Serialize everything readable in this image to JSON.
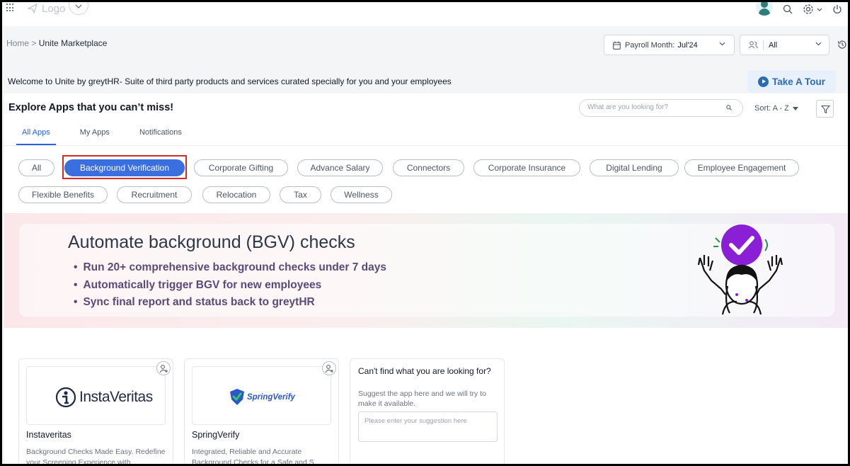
{
  "topbar": {
    "logo_text": "Logo"
  },
  "breadcrumb": {
    "home": "Home",
    "separator": ">",
    "current": "Unite Marketplace"
  },
  "payroll": {
    "label": "Payroll Month:",
    "value": "Jul'24"
  },
  "scope": {
    "value": "All"
  },
  "welcome": {
    "text": "Welcome to Unite by greytHR- Suite of third party products and services curated specially for you and your employees",
    "tour_label": "Take A Tour"
  },
  "explore": {
    "title": "Explore Apps that you can’t miss!",
    "search_placeholder": "What are you looking for?",
    "sort_label": "Sort: A - Z"
  },
  "tabs": [
    {
      "label": "All Apps",
      "active": true
    },
    {
      "label": "My Apps",
      "active": false
    },
    {
      "label": "Notifications",
      "active": false
    }
  ],
  "categories": [
    {
      "label": "All",
      "selected": false
    },
    {
      "label": "Background Verification",
      "selected": true
    },
    {
      "label": "Corporate Gifting",
      "selected": false
    },
    {
      "label": "Advance Salary",
      "selected": false
    },
    {
      "label": "Connectors",
      "selected": false
    },
    {
      "label": "Corporate Insurance",
      "selected": false
    },
    {
      "label": "Digital Lending",
      "selected": false
    },
    {
      "label": "Employee Engagement",
      "selected": false
    },
    {
      "label": "Flexible Benefits",
      "selected": false
    },
    {
      "label": "Recruitment",
      "selected": false
    },
    {
      "label": "Relocation",
      "selected": false
    },
    {
      "label": "Tax",
      "selected": false
    },
    {
      "label": "Wellness",
      "selected": false
    }
  ],
  "banner": {
    "title": "Automate background (BGV) checks",
    "points": [
      "Run 20+ comprehensive background checks under 7 days",
      "Automatically trigger BGV for new employees",
      "Sync final report and status back to greytHR"
    ]
  },
  "cards": [
    {
      "name": "Instaveritas",
      "logo_text": "InstaVeritas",
      "desc_line1": "Background Checks Made Easy. Redefine",
      "desc_line2": "your Screening Experience with..."
    },
    {
      "name": "SpringVerify",
      "logo_text_a": "Spring",
      "logo_text_b": "Verify",
      "desc_line1": "Integrated, Reliable and Accurate",
      "desc_line2": "Background Checks for a Safe and Secu..."
    }
  ],
  "suggest": {
    "question": "Can't find what you are looking for?",
    "hint": "Suggest the app here and we will try to make it available.",
    "placeholder": "Please enter your suggestion here"
  },
  "colors": {
    "accent": "#3b6fe0",
    "highlight_border": "#d62828",
    "tour_bg": "#e8f1fb",
    "tour_text": "#2b6cb0",
    "badge_purple": "#8b1fd6"
  }
}
